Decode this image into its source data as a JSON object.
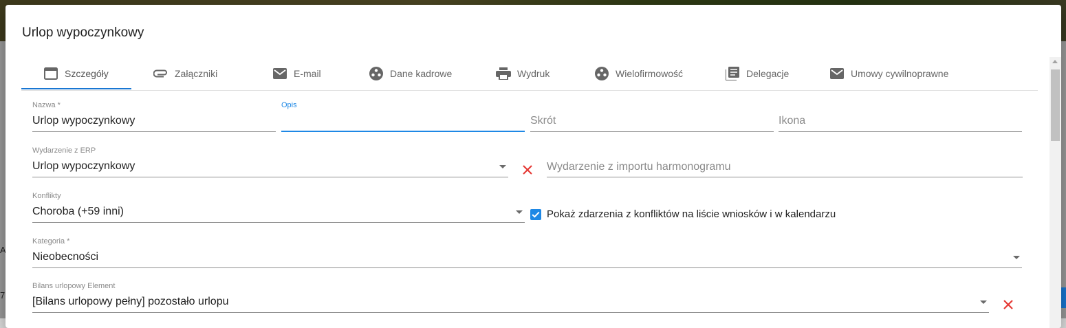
{
  "dialog": {
    "title": "Urlop wypoczynkowy"
  },
  "tabs": [
    {
      "label": "Szczegóły",
      "icon": "card-icon",
      "active": true
    },
    {
      "label": "Załączniki",
      "icon": "paperclip-icon"
    },
    {
      "label": "E-mail",
      "icon": "mail-icon"
    },
    {
      "label": "Dane kadrowe",
      "icon": "people-circle-icon"
    },
    {
      "label": "Wydruk",
      "icon": "printer-icon"
    },
    {
      "label": "Wielofirmowość",
      "icon": "people-circle-icon"
    },
    {
      "label": "Delegacje",
      "icon": "document-list-icon"
    },
    {
      "label": "Umowy cywilnoprawne",
      "icon": "mail-icon"
    }
  ],
  "form": {
    "nazwa": {
      "label": "Nazwa *",
      "value": "Urlop wypoczynkowy"
    },
    "opis": {
      "label": "Opis",
      "value": ""
    },
    "skrot": {
      "placeholder": "Skrót"
    },
    "ikona": {
      "placeholder": "Ikona"
    },
    "wydarzenie_erp": {
      "label": "Wydarzenie z ERP",
      "value": "Urlop wypoczynkowy"
    },
    "wydarzenie_import": {
      "placeholder": "Wydarzenie z importu harmonogramu"
    },
    "konflikty": {
      "label": "Konflikty",
      "value": "Choroba (+59 inni)"
    },
    "pokaz_zdarzenia": {
      "label": "Pokaż zdarzenia z konfliktów na liście wniosków i w kalendarzu",
      "checked": true
    },
    "kategoria": {
      "label": "Kategoria *",
      "value": "Nieobecności"
    },
    "bilans": {
      "label": "Bilans urlopowy Element",
      "value": "[Bilans urlopowy pełny] pozostało urlopu"
    }
  },
  "background": {
    "glimpse1": "A",
    "glimpse2": "7"
  },
  "colors": {
    "accent": "#1e88e5",
    "clear": "#e53935",
    "tab_ink": "#1976d2"
  }
}
